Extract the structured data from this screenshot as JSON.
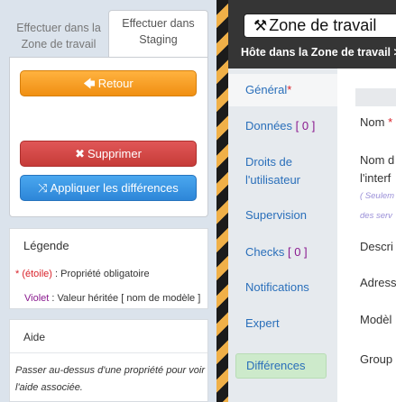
{
  "tabs": {
    "staging_other_line1": "Effectuer dans la",
    "staging_other_line2": "Zone de travail",
    "staging_active_line1": "Effectuer dans",
    "staging_active_line2": "Staging"
  },
  "actions": {
    "back_label": "Retour",
    "delete_label": "Supprimer",
    "apply_label": "Appliquer les différences"
  },
  "legend": {
    "title": "Légende",
    "required_marker": "* (étoile)",
    "required_text": ": Propriété obligatoire",
    "inherited_marker": "Violet",
    "inherited_text": ": Valeur héritée [ nom de modèle ]"
  },
  "help": {
    "title": "Aide",
    "text": "Passer au-dessus d'une propriété pour voir l'aide associée."
  },
  "workspace": {
    "title": "Zone de travail",
    "breadcrumb": "Hôte dans la Zone de travail >"
  },
  "nav": {
    "general": "Général",
    "general_required": "*",
    "donnees": "Données",
    "donnees_count": "[ 0 ]",
    "droits_line1": "Droits de",
    "droits_line2": "l'utilisateur",
    "supervision": "Supervision",
    "checks": "Checks",
    "checks_count": "[ 0 ]",
    "notifications": "Notifications",
    "expert": "Expert",
    "differences": "Différences"
  },
  "fields": {
    "nom": "Nom",
    "nom_required": "*",
    "nom_d_line1": "Nom d",
    "nom_d_line2": "l'interf",
    "note_line1": "( Seulem",
    "note_line2": "des serv",
    "description": "Descri",
    "adresse": "Adress",
    "modele": "Modèl",
    "groupe": "Group"
  },
  "colors": {
    "orange_button": "#f5a02a",
    "red_button": "#d24a47",
    "blue_button": "#3b97e3",
    "link_blue": "#2a6fba",
    "required_red": "#d9222a",
    "inherited_purple": "#8a1a8f",
    "differences_green": "#cdeacb",
    "hazard_stripe": "#f0b048"
  }
}
